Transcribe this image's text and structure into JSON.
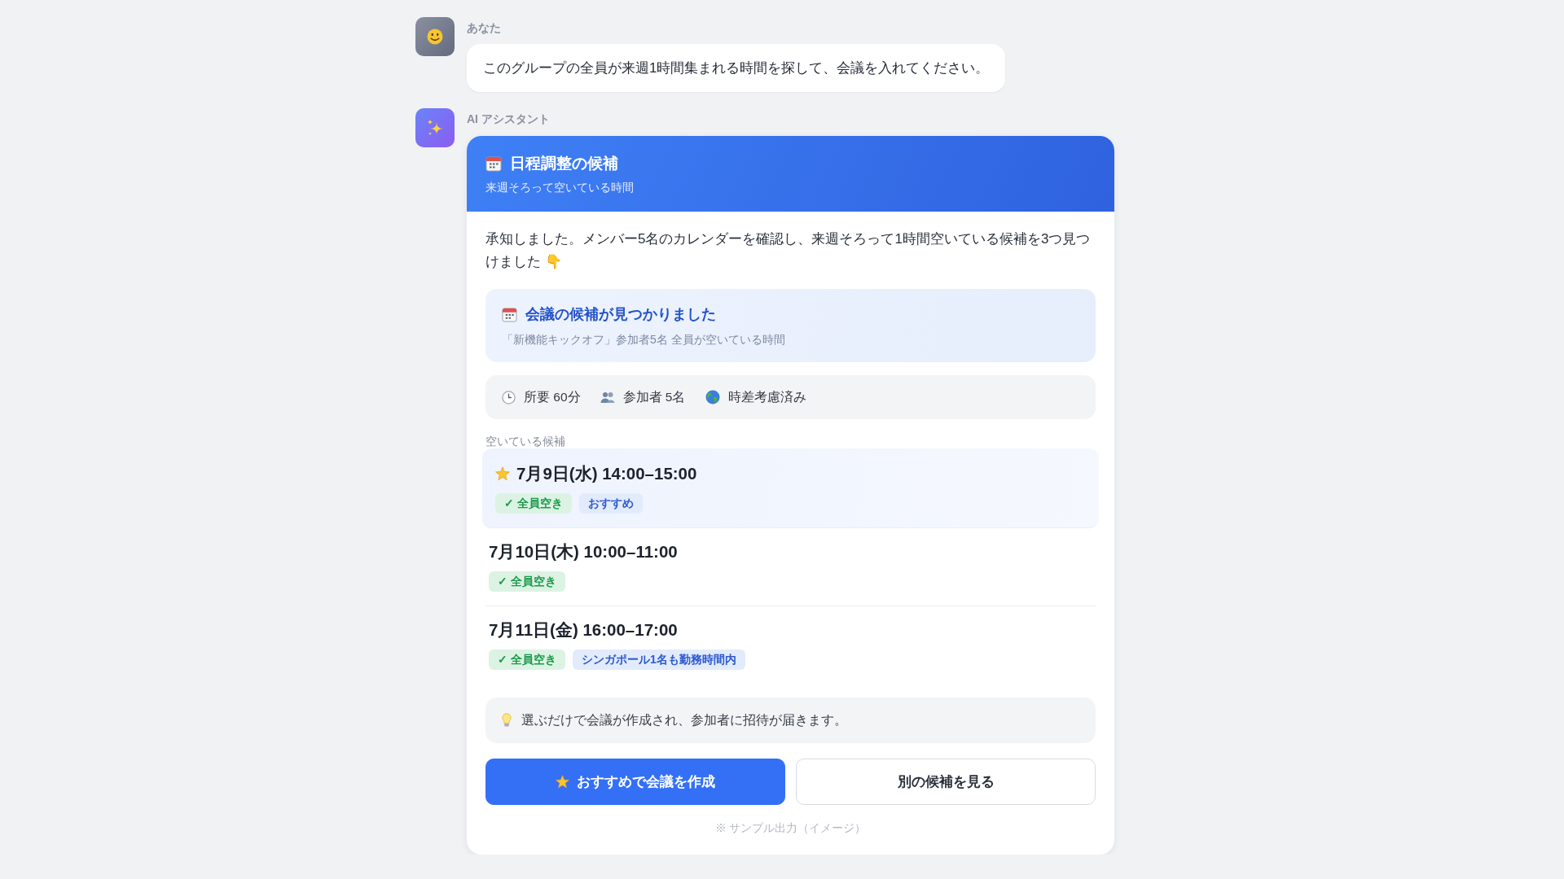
{
  "messages": [
    {
      "kind": "user",
      "sender": "あなた",
      "text": "このグループの全員が来週1時間集まれる時間を探して、会議を入れてください。"
    },
    {
      "kind": "assistant",
      "sender": "AI アシスタント",
      "card": {
        "title": "日程調整の候補",
        "subtitle": "来週そろって空いている時間",
        "intro": "承知しました。メンバー5名のカレンダーを確認し、来週そろって1時間空いている候補を3つ見つけました 👇",
        "found": {
          "title": "会議の候補が見つかりました",
          "subtitle": "「新機能キックオフ」参加者5名 全員が空いている時間"
        },
        "info": [
          "所要 60分",
          "参加者 5名",
          "時差考慮済み"
        ],
        "section_label": "空いている候補",
        "candidates": [
          {
            "datetime": "7月9日(水) 14:00–15:00",
            "recommended": true,
            "tags": [
              {
                "kind": "success",
                "label": "✓ 全員空き"
              },
              {
                "kind": "info",
                "label": "おすすめ"
              }
            ]
          },
          {
            "datetime": "7月10日(木) 10:00–11:00",
            "recommended": false,
            "tags": [
              {
                "kind": "success",
                "label": "✓ 全員空き"
              }
            ]
          },
          {
            "datetime": "7月11日(金) 16:00–17:00",
            "recommended": false,
            "tags": [
              {
                "kind": "success",
                "label": "✓ 全員空き"
              },
              {
                "kind": "info",
                "label": "シンガポール1名も勤務時間内"
              }
            ]
          }
        ],
        "tip": "選ぶだけで会議が作成され、参加者に招待が届きます。",
        "buttons": [
          {
            "kind": "primary",
            "label": "おすすめで会議を作成"
          },
          {
            "kind": "secondary",
            "label": "別の候補を見る"
          }
        ],
        "footnote": "※ サンプル出力（イメージ）"
      }
    }
  ]
}
